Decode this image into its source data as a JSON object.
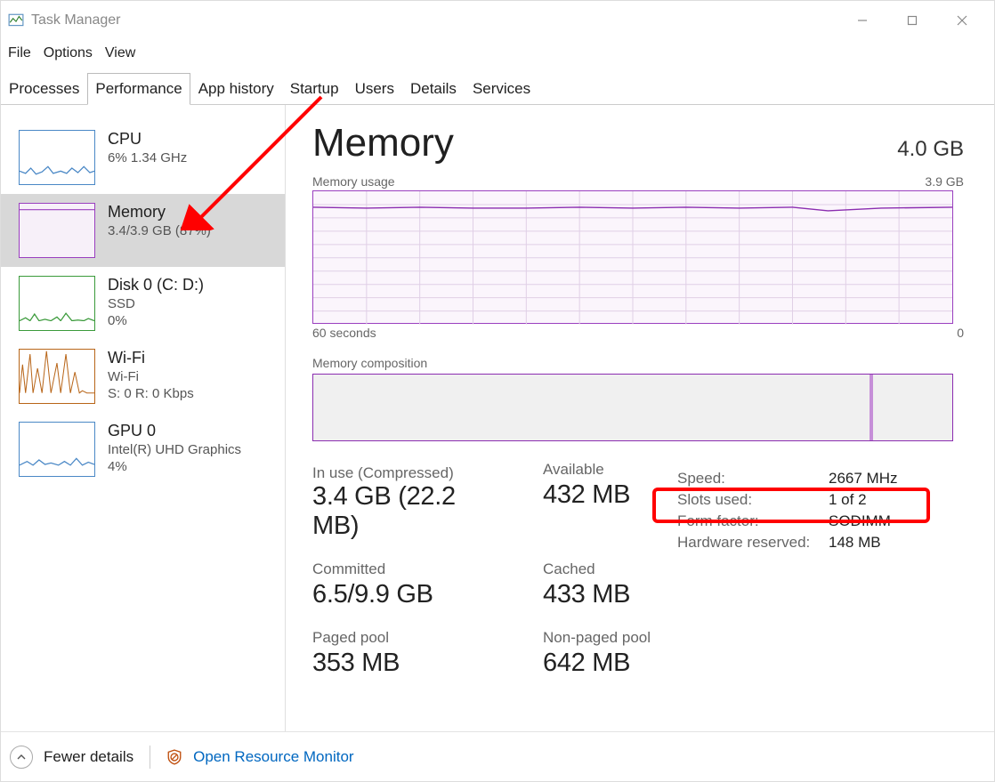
{
  "window": {
    "title": "Task Manager"
  },
  "menus": {
    "file": "File",
    "options": "Options",
    "view": "View"
  },
  "tabs": {
    "processes": "Processes",
    "performance": "Performance",
    "apphistory": "App history",
    "startup": "Startup",
    "users": "Users",
    "details": "Details",
    "services": "Services"
  },
  "sidebar": {
    "cpu": {
      "title": "CPU",
      "line1": "6%  1.34 GHz"
    },
    "mem": {
      "title": "Memory",
      "line1": "3.4/3.9 GB (87%)"
    },
    "disk": {
      "title": "Disk 0 (C: D:)",
      "line1": "SSD",
      "line2": "0%"
    },
    "wifi": {
      "title": "Wi-Fi",
      "line1": "Wi-Fi",
      "line2": "S: 0  R: 0 Kbps"
    },
    "gpu": {
      "title": "GPU 0",
      "line1": "Intel(R) UHD Graphics",
      "line2": "4%"
    }
  },
  "main": {
    "title": "Memory",
    "total": "4.0 GB",
    "usage_label": "Memory usage",
    "usage_max": "3.9 GB",
    "axis_left": "60 seconds",
    "axis_right": "0",
    "comp_label": "Memory composition",
    "stats": {
      "inuse_label": "In use (Compressed)",
      "inuse_value": "3.4 GB (22.2 MB)",
      "available_label": "Available",
      "available_value": "432 MB",
      "committed_label": "Committed",
      "committed_value": "6.5/9.9 GB",
      "cached_label": "Cached",
      "cached_value": "433 MB",
      "paged_label": "Paged pool",
      "paged_value": "353 MB",
      "nonpaged_label": "Non-paged pool",
      "nonpaged_value": "642 MB"
    },
    "kv": {
      "speed_k": "Speed:",
      "speed_v": "2667 MHz",
      "slots_k": "Slots used:",
      "slots_v": "1 of 2",
      "form_k": "Form factor:",
      "form_v": "SODIMM",
      "hw_k": "Hardware reserved:",
      "hw_v": "148 MB"
    }
  },
  "footer": {
    "fewer": "Fewer details",
    "open_rm": "Open Resource Monitor"
  },
  "chart_data": [
    {
      "type": "line",
      "title": "CPU sidebar",
      "x": [
        0,
        10,
        20,
        30,
        40,
        50,
        60,
        70,
        80,
        90,
        100
      ],
      "values": [
        8,
        4,
        12,
        3,
        5,
        18,
        3,
        6,
        4,
        10,
        5
      ],
      "ylim": [
        0,
        100
      ]
    },
    {
      "type": "line",
      "title": "Memory usage (main)",
      "xlabel": "60 seconds → 0",
      "ylabel": "Memory",
      "ylim": [
        0,
        3.9
      ],
      "x": [
        0,
        10,
        20,
        30,
        40,
        50,
        60,
        70,
        80,
        90,
        100
      ],
      "values": [
        3.4,
        3.4,
        3.4,
        3.4,
        3.4,
        3.4,
        3.4,
        3.4,
        3.4,
        3.35,
        3.4
      ]
    },
    {
      "type": "line",
      "title": "Disk sidebar",
      "x": [
        0,
        10,
        20,
        30,
        40,
        50,
        60,
        70,
        80,
        90,
        100
      ],
      "values": [
        0,
        2,
        0,
        8,
        0,
        3,
        0,
        10,
        1,
        0,
        2
      ],
      "ylim": [
        0,
        100
      ]
    },
    {
      "type": "line",
      "title": "Wi-Fi sidebar",
      "x": [
        0,
        10,
        20,
        30,
        40,
        50,
        60,
        70,
        80,
        90,
        100
      ],
      "values": [
        5,
        60,
        10,
        80,
        2,
        70,
        3,
        90,
        12,
        40,
        2
      ],
      "ylim": [
        0,
        100
      ]
    },
    {
      "type": "line",
      "title": "GPU sidebar",
      "x": [
        0,
        10,
        20,
        30,
        40,
        50,
        60,
        70,
        80,
        90,
        100
      ],
      "values": [
        2,
        10,
        3,
        8,
        2,
        6,
        4,
        3,
        12,
        2,
        5
      ],
      "ylim": [
        0,
        100
      ]
    },
    {
      "type": "bar",
      "title": "Memory composition",
      "categories": [
        "In use",
        "Available"
      ],
      "values": [
        87,
        13
      ],
      "ylim": [
        0,
        100
      ]
    }
  ]
}
